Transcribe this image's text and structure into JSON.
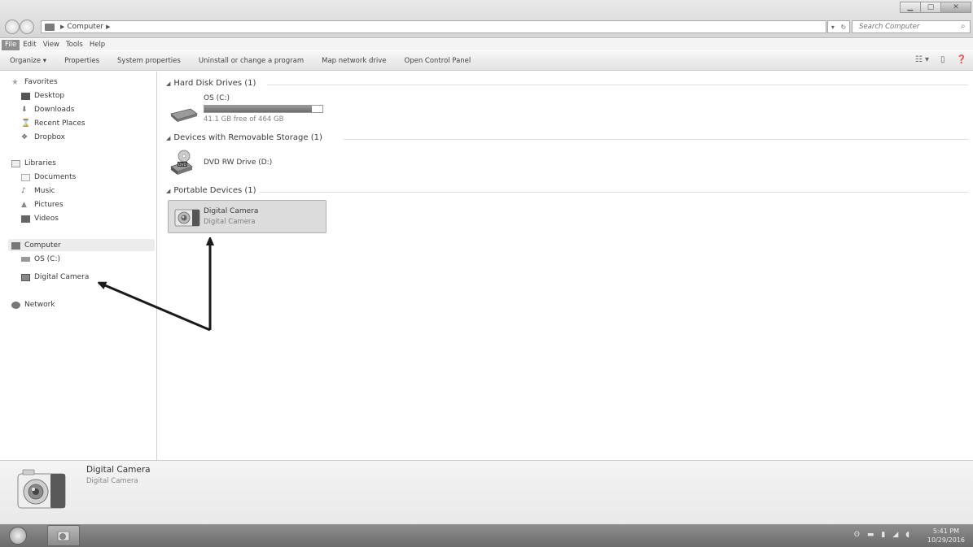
{
  "window": {
    "title_controls": [
      "minimize",
      "maximize",
      "close"
    ]
  },
  "address_bar": {
    "segments": [
      "Computer"
    ],
    "search_placeholder": "Search Computer"
  },
  "menu": {
    "items": [
      "File",
      "Edit",
      "View",
      "Tools",
      "Help"
    ]
  },
  "commands": {
    "items": [
      "Organize ▾",
      "Properties",
      "System properties",
      "Uninstall or change a program",
      "Map network drive",
      "Open Control Panel"
    ]
  },
  "nav": {
    "favorites": "Favorites",
    "desktop": "Desktop",
    "downloads": "Downloads",
    "recent_places": "Recent Places",
    "dropbox": "Dropbox",
    "libraries": "Libraries",
    "documents": "Documents",
    "music": "Music",
    "pictures": "Pictures",
    "videos": "Videos",
    "computer": "Computer",
    "os_c": "OS (C:)",
    "digital_camera": "Digital Camera",
    "network": "Network"
  },
  "content": {
    "hard_disk_header": "Hard Disk Drives (1)",
    "os_drive_name": "OS (C:)",
    "os_drive_free": "41.1 GB free of 464 GB",
    "os_drive_used_fraction": 0.91,
    "removable_header": "Devices with Removable Storage (1)",
    "dvd_drive_name": "DVD RW Drive (D:)",
    "portable_header": "Portable Devices (1)",
    "camera_name": "Digital Camera",
    "camera_type": "Digital Camera"
  },
  "details": {
    "title": "Digital Camera",
    "subtitle": "Digital Camera"
  },
  "taskbar": {
    "time": "5:41 PM",
    "date": "10/29/2016"
  }
}
